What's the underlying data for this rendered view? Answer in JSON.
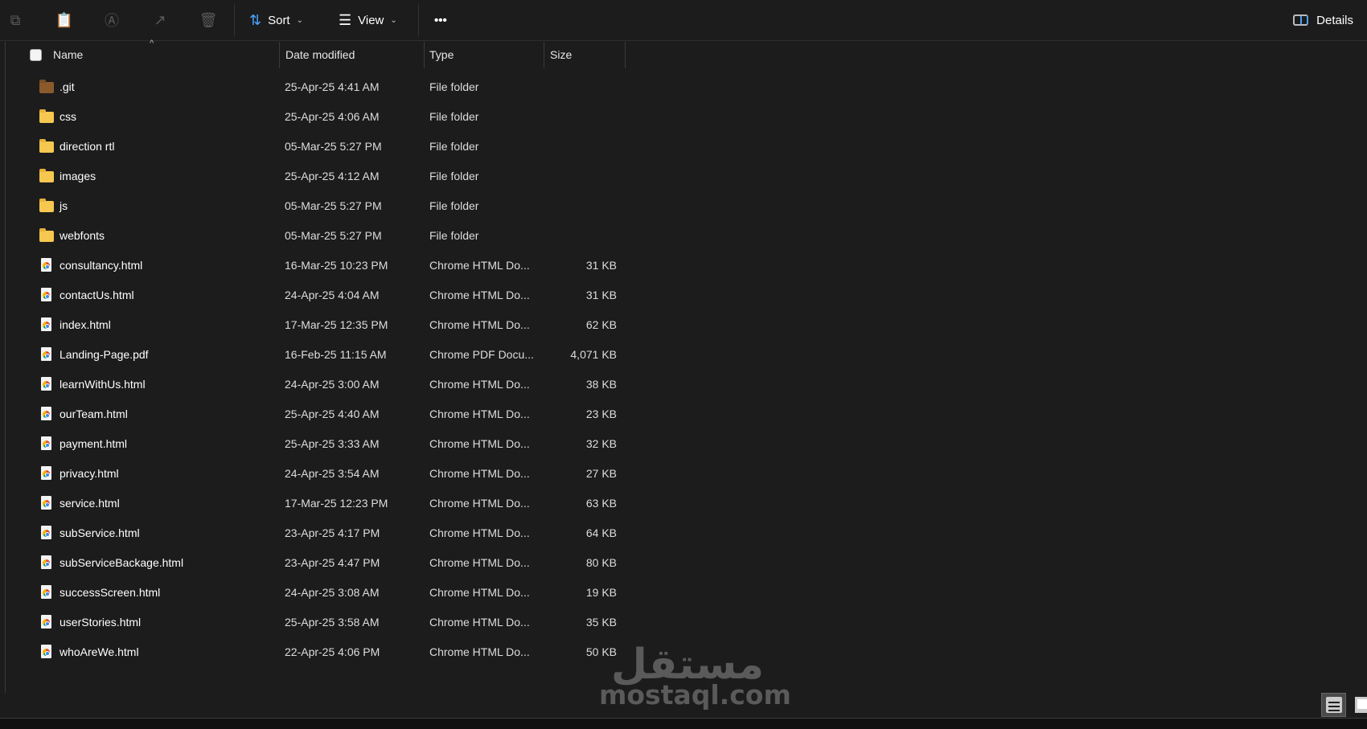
{
  "toolbar": {
    "icons": [
      "copy-icon",
      "paste-icon",
      "rename-icon",
      "share-icon",
      "delete-icon"
    ],
    "sort_label": "Sort",
    "view_label": "View",
    "more_label": "•••",
    "details_label": "Details"
  },
  "columns": {
    "name": "Name",
    "date": "Date modified",
    "type": "Type",
    "size": "Size"
  },
  "files": [
    {
      "name": ".git",
      "date": "25-Apr-25 4:41 AM",
      "type": "File folder",
      "size": "",
      "icon": "git-folder"
    },
    {
      "name": "css",
      "date": "25-Apr-25 4:06 AM",
      "type": "File folder",
      "size": "",
      "icon": "folder"
    },
    {
      "name": "direction rtl",
      "date": "05-Mar-25 5:27 PM",
      "type": "File folder",
      "size": "",
      "icon": "folder"
    },
    {
      "name": "images",
      "date": "25-Apr-25 4:12 AM",
      "type": "File folder",
      "size": "",
      "icon": "folder"
    },
    {
      "name": "js",
      "date": "05-Mar-25 5:27 PM",
      "type": "File folder",
      "size": "",
      "icon": "folder"
    },
    {
      "name": "webfonts",
      "date": "05-Mar-25 5:27 PM",
      "type": "File folder",
      "size": "",
      "icon": "folder"
    },
    {
      "name": "consultancy.html",
      "date": "16-Mar-25 10:23 PM",
      "type": "Chrome HTML Do...",
      "size": "31 KB",
      "icon": "chrome-file"
    },
    {
      "name": "contactUs.html",
      "date": "24-Apr-25 4:04 AM",
      "type": "Chrome HTML Do...",
      "size": "31 KB",
      "icon": "chrome-file"
    },
    {
      "name": "index.html",
      "date": "17-Mar-25 12:35 PM",
      "type": "Chrome HTML Do...",
      "size": "62 KB",
      "icon": "chrome-file"
    },
    {
      "name": "Landing-Page.pdf",
      "date": "16-Feb-25 11:15 AM",
      "type": "Chrome PDF Docu...",
      "size": "4,071 KB",
      "icon": "chrome-file"
    },
    {
      "name": "learnWithUs.html",
      "date": "24-Apr-25 3:00 AM",
      "type": "Chrome HTML Do...",
      "size": "38 KB",
      "icon": "chrome-file"
    },
    {
      "name": "ourTeam.html",
      "date": "25-Apr-25 4:40 AM",
      "type": "Chrome HTML Do...",
      "size": "23 KB",
      "icon": "chrome-file"
    },
    {
      "name": "payment.html",
      "date": "25-Apr-25 3:33 AM",
      "type": "Chrome HTML Do...",
      "size": "32 KB",
      "icon": "chrome-file"
    },
    {
      "name": "privacy.html",
      "date": "24-Apr-25 3:54 AM",
      "type": "Chrome HTML Do...",
      "size": "27 KB",
      "icon": "chrome-file"
    },
    {
      "name": "service.html",
      "date": "17-Mar-25 12:23 PM",
      "type": "Chrome HTML Do...",
      "size": "63 KB",
      "icon": "chrome-file"
    },
    {
      "name": "subService.html",
      "date": "23-Apr-25 4:17 PM",
      "type": "Chrome HTML Do...",
      "size": "64 KB",
      "icon": "chrome-file"
    },
    {
      "name": "subServiceBackage.html",
      "date": "23-Apr-25 4:47 PM",
      "type": "Chrome HTML Do...",
      "size": "80 KB",
      "icon": "chrome-file"
    },
    {
      "name": "successScreen.html",
      "date": "24-Apr-25 3:08 AM",
      "type": "Chrome HTML Do...",
      "size": "19 KB",
      "icon": "chrome-file"
    },
    {
      "name": "userStories.html",
      "date": "25-Apr-25 3:58 AM",
      "type": "Chrome HTML Do...",
      "size": "35 KB",
      "icon": "chrome-file"
    },
    {
      "name": "whoAreWe.html",
      "date": "22-Apr-25 4:06 PM",
      "type": "Chrome HTML Do...",
      "size": "50 KB",
      "icon": "chrome-file"
    }
  ],
  "watermark": {
    "arabic": "مستقل",
    "latin": "mostaql.com"
  },
  "colors": {
    "background": "#1c1c1c",
    "folder": "#f6c84f",
    "accent": "#4aa3ff"
  }
}
